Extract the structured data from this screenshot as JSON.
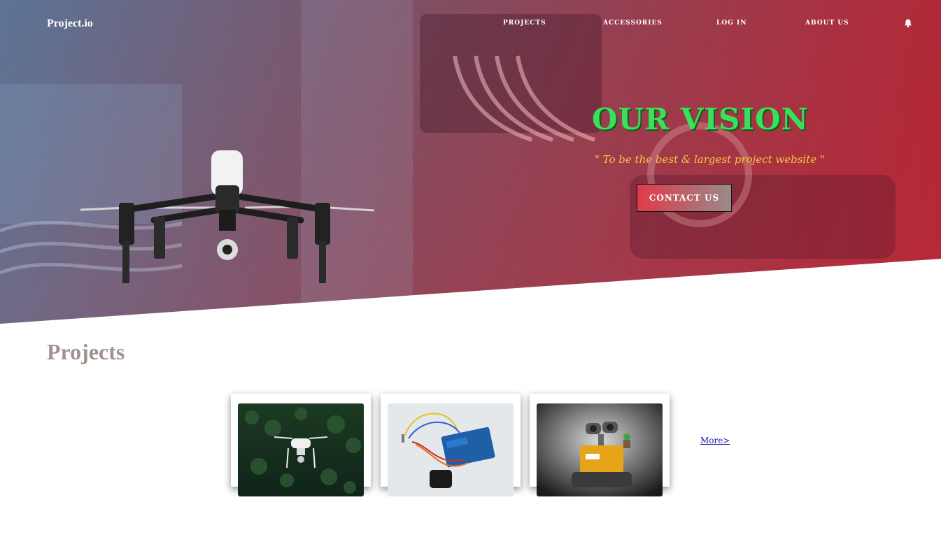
{
  "brand": "Project.io",
  "nav": {
    "items": [
      {
        "label": "PROJECTS"
      },
      {
        "label": "ACCESSORIES"
      },
      {
        "label": "LOG IN"
      },
      {
        "label": "ABOUT US"
      }
    ],
    "notification_icon": "bell-icon"
  },
  "hero": {
    "title": "OUR VISION",
    "quote": "\" To be the best & largest project website \"",
    "cta_label": "CONTACT US",
    "image": "drone-over-electronics"
  },
  "projects": {
    "title": "Projects",
    "cards": [
      {
        "image": "drone-over-forest"
      },
      {
        "image": "arduino-board-with-sensor"
      },
      {
        "image": "wall-e-robot"
      }
    ],
    "more_label": "More>"
  },
  "colors": {
    "hero_title": "#3be05a",
    "hero_quote": "#f5c63a",
    "section_title": "#a0938f",
    "link": "#1a1aa6"
  }
}
